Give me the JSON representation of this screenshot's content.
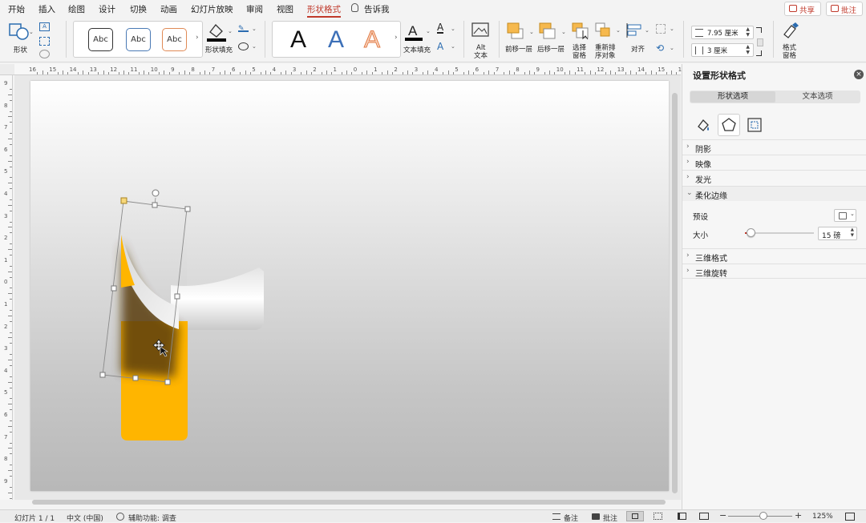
{
  "menu": {
    "items": [
      "开始",
      "插入",
      "绘图",
      "设计",
      "切换",
      "动画",
      "幻灯片放映",
      "审阅",
      "视图",
      "形状格式"
    ],
    "active_index": 9,
    "tell_me": "告诉我",
    "share": "共享",
    "comment": "批注"
  },
  "ribbon": {
    "shape_label": "形状",
    "style_gallery": [
      "Abc",
      "Abc",
      "Abc"
    ],
    "shape_fill_label": "形状填充",
    "wordart": [
      "A",
      "A",
      "A"
    ],
    "text_fill_label": "文本填充",
    "alt_text_label_1": "Alt",
    "alt_text_label_2": "文本",
    "bring_forward_label": "前移一层",
    "send_backward_label": "后移一层",
    "selection_pane_label_1": "选择",
    "selection_pane_label_2": "窗格",
    "reorder_label_1": "重新排",
    "reorder_label_2": "序对象",
    "align_label": "对齐",
    "height_value": "7.95 厘米",
    "width_value": "3 厘米",
    "format_pane_label_1": "格式",
    "format_pane_label_2": "窗格"
  },
  "ruler": {
    "h_numbers": [
      "16",
      "15",
      "14",
      "13",
      "12",
      "11",
      "10",
      "9",
      "8",
      "7",
      "6",
      "5",
      "4",
      "3",
      "2",
      "1",
      "0",
      "1",
      "2",
      "3",
      "4",
      "5",
      "6",
      "7",
      "8",
      "9",
      "10",
      "11",
      "12",
      "13",
      "14",
      "15",
      "16"
    ],
    "v_numbers": [
      "9",
      "8",
      "7",
      "6",
      "5",
      "4",
      "3",
      "2",
      "1",
      "0",
      "1",
      "2",
      "3",
      "4",
      "5",
      "6",
      "7",
      "8",
      "9"
    ]
  },
  "panel": {
    "title": "设置形状格式",
    "tab_shape": "形状选项",
    "tab_text": "文本选项",
    "sections": [
      "阴影",
      "映像",
      "发光",
      "柔化边缘"
    ],
    "preset_label": "预设",
    "size_label": "大小",
    "size_value": "15 磅",
    "size_fraction": 0.08,
    "sections_after": [
      "三维格式",
      "三维旋转"
    ]
  },
  "status": {
    "slide": "幻灯片 1 / 1",
    "language": "中文 (中国)",
    "accessibility": "辅助功能: 调查",
    "notes": "备注",
    "comments": "批注",
    "zoom": "125%",
    "zoom_fraction": 0.55
  },
  "colors": {
    "accent": "#c0392b",
    "yellow": "#ffb500",
    "brown": "#6b4a0e"
  }
}
